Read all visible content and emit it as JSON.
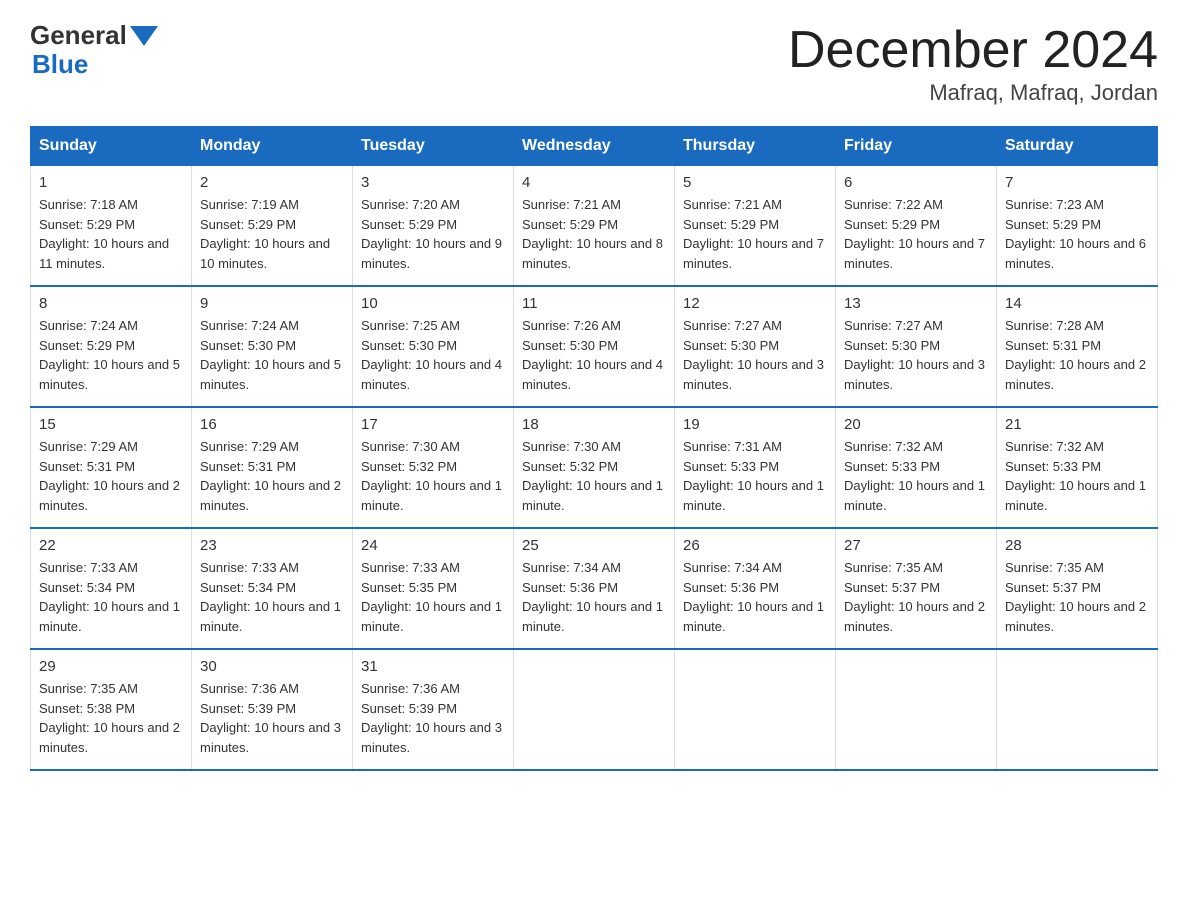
{
  "logo": {
    "general": "General",
    "blue": "Blue"
  },
  "title": "December 2024",
  "location": "Mafraq, Mafraq, Jordan",
  "days_header": [
    "Sunday",
    "Monday",
    "Tuesday",
    "Wednesday",
    "Thursday",
    "Friday",
    "Saturday"
  ],
  "weeks": [
    [
      {
        "day": "1",
        "sunrise": "7:18 AM",
        "sunset": "5:29 PM",
        "daylight": "10 hours and 11 minutes."
      },
      {
        "day": "2",
        "sunrise": "7:19 AM",
        "sunset": "5:29 PM",
        "daylight": "10 hours and 10 minutes."
      },
      {
        "day": "3",
        "sunrise": "7:20 AM",
        "sunset": "5:29 PM",
        "daylight": "10 hours and 9 minutes."
      },
      {
        "day": "4",
        "sunrise": "7:21 AM",
        "sunset": "5:29 PM",
        "daylight": "10 hours and 8 minutes."
      },
      {
        "day": "5",
        "sunrise": "7:21 AM",
        "sunset": "5:29 PM",
        "daylight": "10 hours and 7 minutes."
      },
      {
        "day": "6",
        "sunrise": "7:22 AM",
        "sunset": "5:29 PM",
        "daylight": "10 hours and 7 minutes."
      },
      {
        "day": "7",
        "sunrise": "7:23 AM",
        "sunset": "5:29 PM",
        "daylight": "10 hours and 6 minutes."
      }
    ],
    [
      {
        "day": "8",
        "sunrise": "7:24 AM",
        "sunset": "5:29 PM",
        "daylight": "10 hours and 5 minutes."
      },
      {
        "day": "9",
        "sunrise": "7:24 AM",
        "sunset": "5:30 PM",
        "daylight": "10 hours and 5 minutes."
      },
      {
        "day": "10",
        "sunrise": "7:25 AM",
        "sunset": "5:30 PM",
        "daylight": "10 hours and 4 minutes."
      },
      {
        "day": "11",
        "sunrise": "7:26 AM",
        "sunset": "5:30 PM",
        "daylight": "10 hours and 4 minutes."
      },
      {
        "day": "12",
        "sunrise": "7:27 AM",
        "sunset": "5:30 PM",
        "daylight": "10 hours and 3 minutes."
      },
      {
        "day": "13",
        "sunrise": "7:27 AM",
        "sunset": "5:30 PM",
        "daylight": "10 hours and 3 minutes."
      },
      {
        "day": "14",
        "sunrise": "7:28 AM",
        "sunset": "5:31 PM",
        "daylight": "10 hours and 2 minutes."
      }
    ],
    [
      {
        "day": "15",
        "sunrise": "7:29 AM",
        "sunset": "5:31 PM",
        "daylight": "10 hours and 2 minutes."
      },
      {
        "day": "16",
        "sunrise": "7:29 AM",
        "sunset": "5:31 PM",
        "daylight": "10 hours and 2 minutes."
      },
      {
        "day": "17",
        "sunrise": "7:30 AM",
        "sunset": "5:32 PM",
        "daylight": "10 hours and 1 minute."
      },
      {
        "day": "18",
        "sunrise": "7:30 AM",
        "sunset": "5:32 PM",
        "daylight": "10 hours and 1 minute."
      },
      {
        "day": "19",
        "sunrise": "7:31 AM",
        "sunset": "5:33 PM",
        "daylight": "10 hours and 1 minute."
      },
      {
        "day": "20",
        "sunrise": "7:32 AM",
        "sunset": "5:33 PM",
        "daylight": "10 hours and 1 minute."
      },
      {
        "day": "21",
        "sunrise": "7:32 AM",
        "sunset": "5:33 PM",
        "daylight": "10 hours and 1 minute."
      }
    ],
    [
      {
        "day": "22",
        "sunrise": "7:33 AM",
        "sunset": "5:34 PM",
        "daylight": "10 hours and 1 minute."
      },
      {
        "day": "23",
        "sunrise": "7:33 AM",
        "sunset": "5:34 PM",
        "daylight": "10 hours and 1 minute."
      },
      {
        "day": "24",
        "sunrise": "7:33 AM",
        "sunset": "5:35 PM",
        "daylight": "10 hours and 1 minute."
      },
      {
        "day": "25",
        "sunrise": "7:34 AM",
        "sunset": "5:36 PM",
        "daylight": "10 hours and 1 minute."
      },
      {
        "day": "26",
        "sunrise": "7:34 AM",
        "sunset": "5:36 PM",
        "daylight": "10 hours and 1 minute."
      },
      {
        "day": "27",
        "sunrise": "7:35 AM",
        "sunset": "5:37 PM",
        "daylight": "10 hours and 2 minutes."
      },
      {
        "day": "28",
        "sunrise": "7:35 AM",
        "sunset": "5:37 PM",
        "daylight": "10 hours and 2 minutes."
      }
    ],
    [
      {
        "day": "29",
        "sunrise": "7:35 AM",
        "sunset": "5:38 PM",
        "daylight": "10 hours and 2 minutes."
      },
      {
        "day": "30",
        "sunrise": "7:36 AM",
        "sunset": "5:39 PM",
        "daylight": "10 hours and 3 minutes."
      },
      {
        "day": "31",
        "sunrise": "7:36 AM",
        "sunset": "5:39 PM",
        "daylight": "10 hours and 3 minutes."
      },
      null,
      null,
      null,
      null
    ]
  ]
}
